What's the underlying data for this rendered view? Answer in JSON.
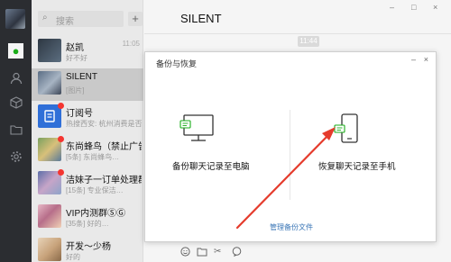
{
  "search": {
    "placeholder": "搜索",
    "add_button": "+"
  },
  "conversations": [
    {
      "name": "赵凯",
      "preview": "好不好",
      "time": "11:05",
      "unread": false,
      "color": "#3d4a58"
    },
    {
      "name": "SILENT",
      "preview": "[图片]",
      "time": "",
      "unread": false,
      "color": "#7c8ea3"
    },
    {
      "name": "订阅号",
      "preview": "热搜西安: 杭州消费是否…",
      "time": "",
      "unread": true,
      "color": "#2f6fd8"
    },
    {
      "name": "东尚蜂鸟（禁止广告…",
      "preview": "[5条] 东尚蜂鸟…",
      "time": "",
      "unread": true,
      "color": "#6a8f56"
    },
    {
      "name": "洁妹子一订单处理群",
      "preview": "[15条] 专业保洁…",
      "time": "",
      "unread": true,
      "color": "#5d6ea8"
    },
    {
      "name": "VIP内测群ⓈⒼ",
      "preview": "[35条] 好的…",
      "time": "",
      "unread": false,
      "color": "#b76e8a"
    },
    {
      "name": "开发～少杨",
      "preview": "好的",
      "time": "",
      "unread": false,
      "color": "#c7a27a"
    }
  ],
  "chat": {
    "title": "SILENT",
    "timestamp": "11:44",
    "window_controls": [
      "–",
      "□",
      "×"
    ]
  },
  "dialog": {
    "title": "备份与恢复",
    "minimize": "–",
    "close": "×",
    "backup_label": "备份聊天记录至电脑",
    "restore_label": "恢复聊天记录至手机",
    "manage_link": "管理备份文件"
  },
  "toolbar_icons": [
    "emoji-icon",
    "folder-icon",
    "scissors-icon",
    "speech-icon"
  ],
  "colors": {
    "accent_green": "#1aad19",
    "arrow_red": "#e53b2c",
    "link_blue": "#3a76b6"
  }
}
